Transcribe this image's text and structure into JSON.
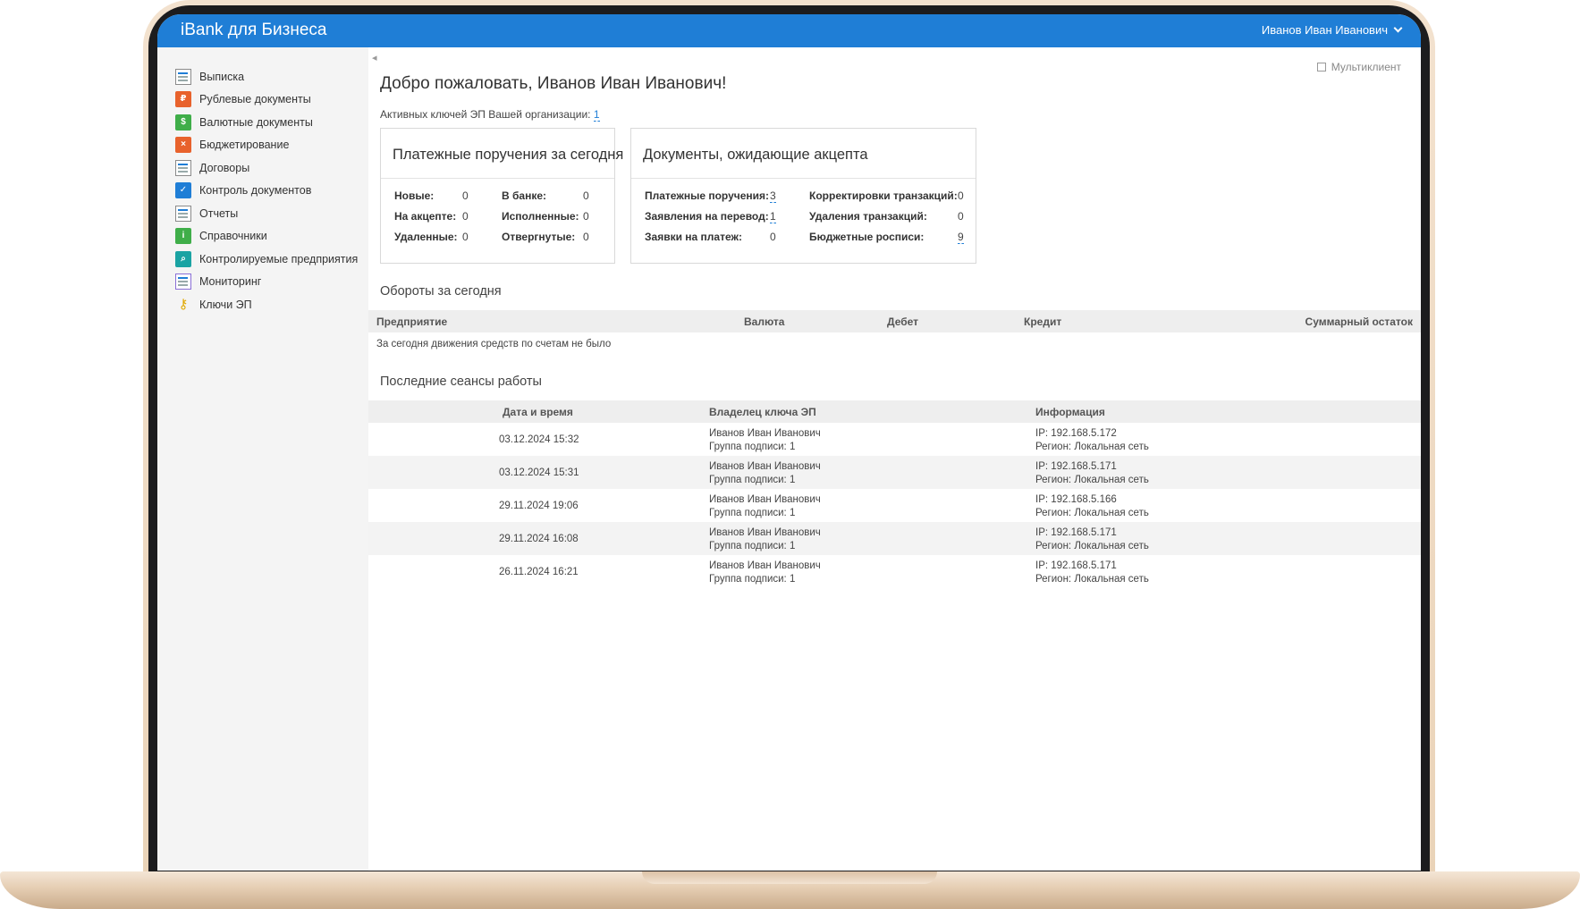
{
  "header": {
    "brand": "iBank для Бизнеса",
    "user": "Иванов Иван Иванович"
  },
  "sidebar": {
    "items": [
      {
        "label": "Выписка",
        "icon": "statement-icon"
      },
      {
        "label": "Рублевые документы",
        "icon": "ruble-docs-icon"
      },
      {
        "label": "Валютные документы",
        "icon": "currency-docs-icon"
      },
      {
        "label": "Бюджетирование",
        "icon": "budget-icon"
      },
      {
        "label": "Договоры",
        "icon": "contracts-icon"
      },
      {
        "label": "Контроль документов",
        "icon": "doc-control-icon"
      },
      {
        "label": "Отчеты",
        "icon": "reports-icon"
      },
      {
        "label": "Справочники",
        "icon": "directories-icon"
      },
      {
        "label": "Контролируемые предприятия",
        "icon": "controlled-companies-icon"
      },
      {
        "label": "Мониторинг",
        "icon": "monitoring-icon"
      },
      {
        "label": "Ключи ЭП",
        "icon": "key-icon"
      }
    ]
  },
  "main": {
    "welcome": "Добро пожаловать, Иванов Иван Иванович!",
    "multiclient": "Мультиклиент",
    "keys_label": "Активных ключей ЭП Вашей организации:",
    "keys_count": "1",
    "payments_card": {
      "title": "Платежные поручения за сегодня",
      "items": [
        {
          "label": "Новые:",
          "value": "0"
        },
        {
          "label": "На акцепте:",
          "value": "0"
        },
        {
          "label": "Удаленные:",
          "value": "0"
        },
        {
          "label": "В банке:",
          "value": "0"
        },
        {
          "label": "Исполненные:",
          "value": "0"
        },
        {
          "label": "Отвергнутые:",
          "value": "0"
        }
      ]
    },
    "accept_card": {
      "title": "Документы, ожидающие акцепта",
      "items": [
        {
          "label": "Платежные поручения:",
          "value": "3"
        },
        {
          "label": "Заявления на перевод:",
          "value": "1"
        },
        {
          "label": "Заявки на платеж:",
          "value": "0"
        },
        {
          "label": "Корректировки транзакций:",
          "value": "0"
        },
        {
          "label": "Удаления транзакций:",
          "value": "0"
        },
        {
          "label": "Бюджетные росписи:",
          "value": "9"
        }
      ]
    },
    "turnover": {
      "title": "Обороты за сегодня",
      "columns": [
        "Предприятие",
        "Валюта",
        "Дебет",
        "Кредит",
        "Суммарный остаток"
      ],
      "empty_text": "За сегодня движения средств по счетам не было"
    },
    "sessions": {
      "title": "Последние сеансы работы",
      "columns": [
        "Дата и время",
        "Владелец ключа ЭП",
        "Информация"
      ],
      "rows": [
        {
          "datetime": "03.12.2024 15:32",
          "owner": "Иванов Иван Иванович",
          "group": "Группа подписи: 1",
          "ip": "IP: 192.168.5.172",
          "region": "Регион: Локальная сеть"
        },
        {
          "datetime": "03.12.2024 15:31",
          "owner": "Иванов Иван Иванович",
          "group": "Группа подписи: 1",
          "ip": "IP: 192.168.5.171",
          "region": "Регион: Локальная сеть"
        },
        {
          "datetime": "29.11.2024 19:06",
          "owner": "Иванов Иван Иванович",
          "group": "Группа подписи: 1",
          "ip": "IP: 192.168.5.166",
          "region": "Регион: Локальная сеть"
        },
        {
          "datetime": "29.11.2024 16:08",
          "owner": "Иванов Иван Иванович",
          "group": "Группа подписи: 1",
          "ip": "IP: 192.168.5.171",
          "region": "Регион: Локальная сеть"
        },
        {
          "datetime": "26.11.2024 16:21",
          "owner": "Иванов Иван Иванович",
          "group": "Группа подписи: 1",
          "ip": "IP: 192.168.5.171",
          "region": "Регион: Локальная сеть"
        }
      ]
    }
  },
  "colors": {
    "topbar": "#1f7ed6",
    "link": "#1f7ed6",
    "frame": "#ead3b8"
  }
}
